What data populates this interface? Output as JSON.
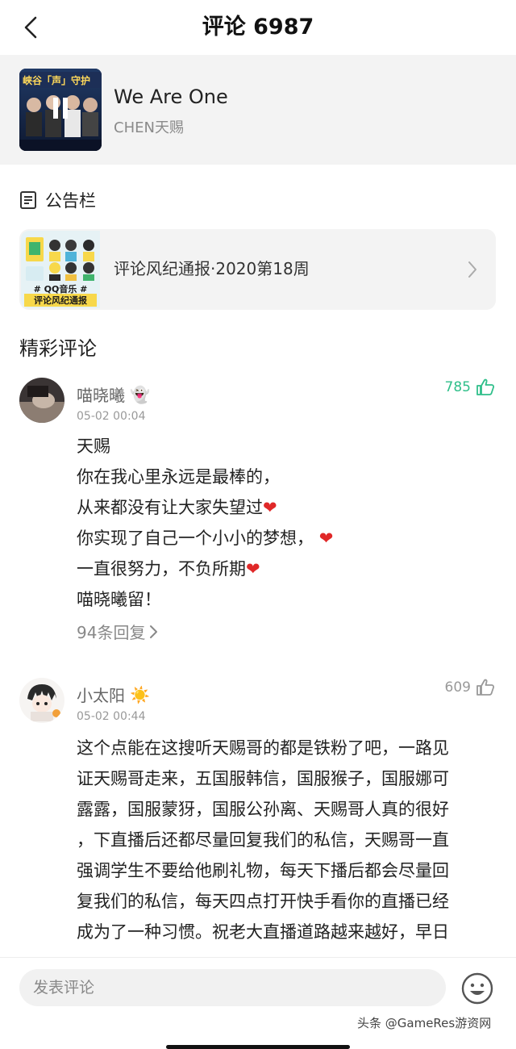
{
  "header": {
    "title": "评论 6987"
  },
  "song": {
    "title": "We Are One",
    "artist": "CHEN天赐",
    "cover_text": "峡谷「声」守护"
  },
  "notice": {
    "heading": "公告栏",
    "item_text": "评论风纪通报·2020第18周",
    "thumb_caption_1": "# QQ音乐 #",
    "thumb_caption_2": "评论风纪通报"
  },
  "section": {
    "title": "精彩评论"
  },
  "comments": [
    {
      "username": "喵晓曦",
      "username_emoji": "👻",
      "time": "05-02 00:04",
      "likes": "785",
      "lines": [
        "天赐",
        "你在我心里永远是最棒的，",
        "从来都没有让大家失望过",
        "你实现了自己一个小小的梦想，",
        "一直很努力，不负所期",
        "喵晓曦留！"
      ],
      "replies": "94条回复"
    },
    {
      "username": "小太阳",
      "username_emoji": "☀️",
      "time": "05-02 00:44",
      "likes": "609",
      "lines": [
        "这个点能在这搜听天赐哥的都是铁粉了吧，一路见",
        "证天赐哥走来，五国服韩信，国服猴子，国服娜可",
        "露露，国服蒙犽，国服公孙离、天赐哥人真的很好",
        "，下直播后还都尽量回复我们的私信，天赐哥一直",
        "强调学生不要给他刷礼物，每天下播后都会尽量回",
        "复我们的私信，每天四点打开快手看你的直播已经",
        "成为了一种习惯。祝老大直播道路越来越好，早日"
      ]
    }
  ],
  "input": {
    "placeholder": "发表评论"
  },
  "watermark": "头条 @GameRes游资网",
  "colors": {
    "accent_green": "#2fbf8a",
    "heart_red": "#e02828",
    "muted": "#888888"
  }
}
